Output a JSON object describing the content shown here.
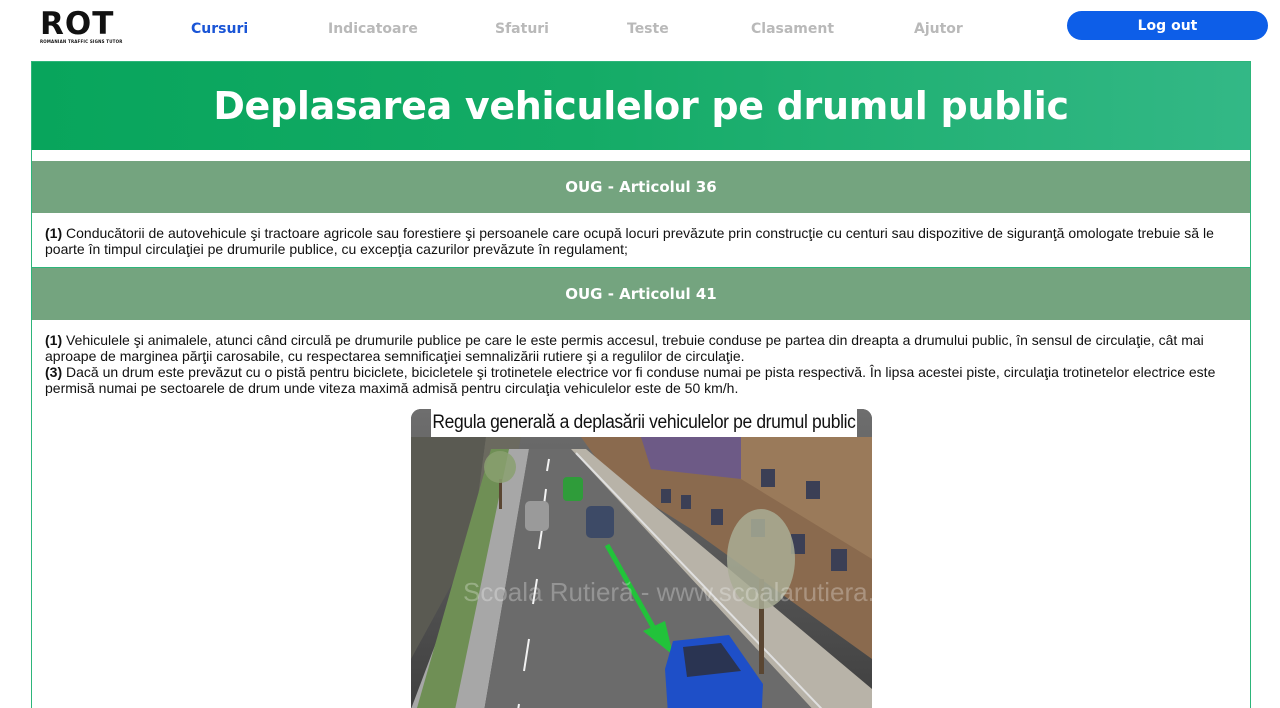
{
  "header": {
    "logo": {
      "text": "ROT",
      "subtitle": "ROMANIAN TRAFFIC SIGNS TUTOR"
    },
    "nav": [
      {
        "label": "Cursuri",
        "active": true
      },
      {
        "label": "Indicatoare",
        "active": false
      },
      {
        "label": "Sfaturi",
        "active": false
      },
      {
        "label": "Teste",
        "active": false
      },
      {
        "label": "Clasament",
        "active": false
      },
      {
        "label": "Ajutor",
        "active": false
      }
    ],
    "logout_label": "Log out"
  },
  "page": {
    "title": "Deplasarea vehiculelor pe drumul public"
  },
  "articles": [
    {
      "heading": "OUG - Articolul 36",
      "paragraphs": [
        {
          "num": "(1)",
          "text": " Conducătorii de autovehicule şi tractoare agricole sau forestiere şi persoanele care ocupă locuri prevăzute prin construcţie cu centuri sau dispozitive de siguranţă omologate trebuie să le poarte în timpul circulaţiei pe drumurile publice, cu excepţia cazurilor prevăzute în regulament;"
        }
      ]
    },
    {
      "heading": "OUG - Articolul 41",
      "paragraphs": [
        {
          "num": "(1)",
          "text": " Vehiculele şi animalele, atunci când circulă pe drumurile publice pe care le este permis accesul, trebuie conduse pe partea din dreapta a drumului public, în sensul de circulaţie, cât mai aproape de marginea părţii carosabile, cu respectarea semnificaţiei semnalizării rutiere şi a regulilor de circulaţie."
        },
        {
          "num": "(3)",
          "text": " Dacă un drum este prevăzut cu o pistă pentru biciclete, bicicletele şi trotinetele electrice vor fi conduse numai pe pista respectivă. În lipsa acestei piste, circulaţia trotinetelor electrice este permisă numai pe sectoarele de drum unde viteza maximă admisă pentru circulaţia vehiculelor este de 50 km/h."
        }
      ],
      "figure": {
        "caption": "Regula generală a deplasării vehiculelor pe drumul public",
        "watermark": "Scoala Rutieră - www.scoalarutiera.ro"
      }
    }
  ],
  "colors": {
    "active_nav": "#1a55d6",
    "inactive_nav": "#b9b9b9",
    "logout_bg": "#0d5ee8",
    "hero_green": "#08a55c",
    "article_head": "#74a47f",
    "frame_border": "#2db57a",
    "car_blue": "#1e4fc8",
    "arrow_green": "#22c33a"
  }
}
